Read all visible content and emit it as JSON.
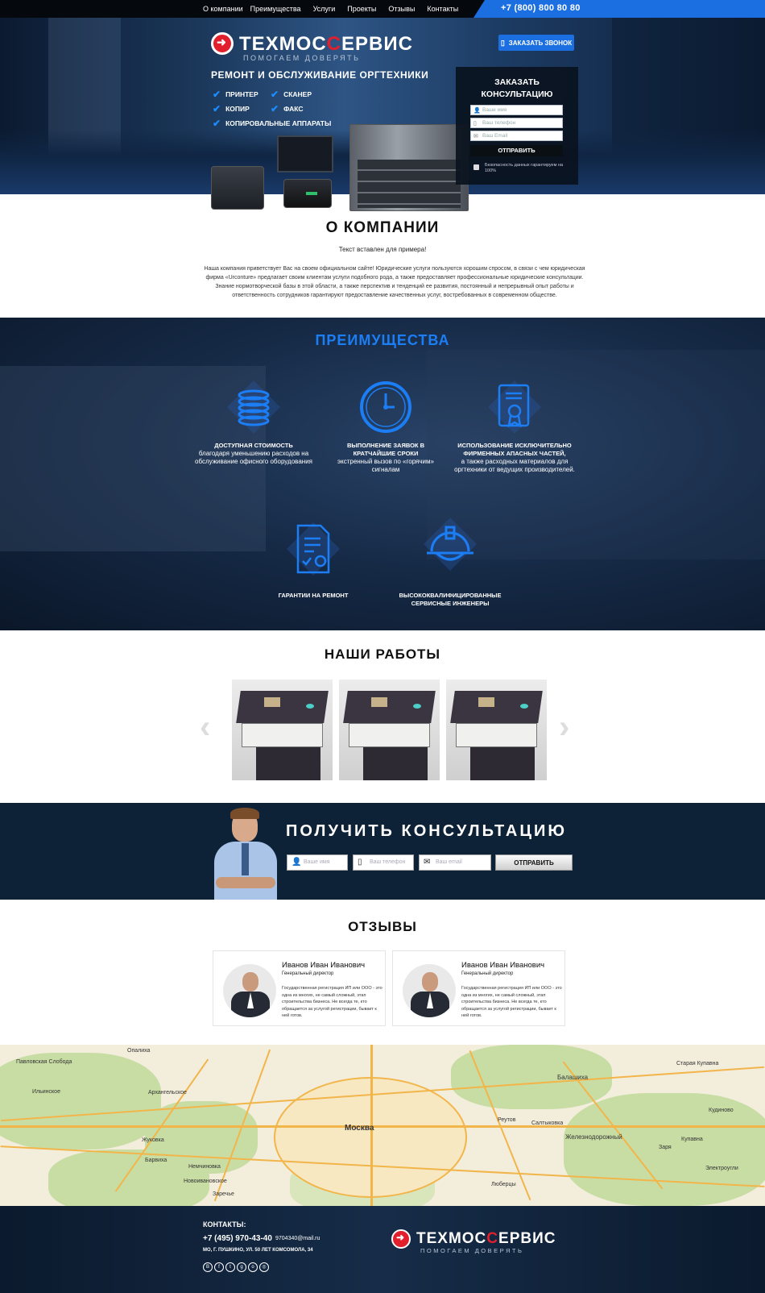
{
  "topbar": {
    "nav": [
      "О компании",
      "Преимущества",
      "Услуги",
      "Проекты",
      "Отзывы",
      "Контакты"
    ],
    "phone": "+7 (800) 800 80 80"
  },
  "logo": {
    "text_a": "ТЕХМОС",
    "text_b": "С",
    "text_c": "ЕРВИС",
    "slogan": "ПОМОГАЕМ ДОВЕРЯТЬ"
  },
  "hero": {
    "call_button": "ЗАКАЗАТЬ ЗВОНОК",
    "title": "РЕМОНТ И ОБСЛУЖИВАНИЕ ОРГТЕХНИКИ",
    "features": [
      "ПРИНТЕР",
      "СКАНЕР",
      "КОПИР",
      "ФАКС",
      "КОПИРОВАЛЬНЫЕ АППАРАТЫ"
    ]
  },
  "consult_form": {
    "title_line1": "ЗАКАЗАТЬ",
    "title_line2": "КОНСУЛЬТАЦИЮ",
    "name_placeholder": "Ваше имя",
    "phone_placeholder": "Ваш телефон",
    "email_placeholder": "Ваш Email",
    "submit": "ОТПРАВИТЬ",
    "security": "Безопасность данных гарантируем на 100%"
  },
  "about": {
    "title": "О КОМПАНИИ",
    "subtitle": "Текст вставлен для примера!",
    "text": "Наша компания приветствует Вас на своем официальном сайте! Юридические услуги пользуются  хорошим спросом, в связи с чем юридическая фирма «Urconture» предлагает своим клиентам услуги подобного рода, а также предоставляет профессиональные юридические консультации. Знание нормотворческой базы в этой области, а также перспектив и тенденций ее развития, постоянный и непрерывный опыт работы и ответственность сотрудников гарантируют предоставление качественных услуг, востребованных в современном обществе."
  },
  "advantages": {
    "title": "ПРЕИМУЩЕСТВА",
    "items": [
      {
        "icon": "coins-icon",
        "heading": "ДОСТУПНАЯ СТОИМОСТЬ",
        "text": "благодаря уменьшению расходов на обслуживание офисного оборудования"
      },
      {
        "icon": "clock-icon",
        "heading": "ВЫПОЛНЕНИЕ ЗАЯВОК В КРАТЧАЙШИЕ СРОКИ",
        "text": "экстренный вызов по «горячим» сигналам"
      },
      {
        "icon": "certificate-icon",
        "heading": "ИСПОЛЬЗОВАНИЕ ИСКЛЮЧИТЕЛЬНО ФИРМЕННЫХ АПАСНЫХ ЧАСТЕЙ,",
        "text": "а также расходных материалов для оргтехники от ведущих производителей."
      },
      {
        "icon": "document-icon",
        "heading": "ГАРАНТИИ НА РЕМОНТ",
        "text": ""
      },
      {
        "icon": "helmet-icon",
        "heading": "ВЫСОКОКВАЛИФИЦИРОВАННЫЕ СЕРВИСНЫЕ ИНЖЕНЕРЫ",
        "text": ""
      }
    ]
  },
  "works": {
    "title": "НАШИ РАБОТЫ"
  },
  "consult_strip": {
    "title": "ПОЛУЧИТЬ   КОНСУЛЬТАЦИЮ",
    "name_placeholder": "Ваше имя",
    "phone_placeholder": "Ваш телефон",
    "email_placeholder": "Ваш email",
    "submit": "ОТПРАВИТЬ"
  },
  "reviews": {
    "title": "ОТЗЫВЫ",
    "items": [
      {
        "name": "Иванов Иван Иванович",
        "position": "Генеральный директор",
        "text": "Государственная регистрация ИП или ООО - это одна из многих, не самый сложный, этап строительства бизнеса. Не всегда те, кто обращается за услугой регистрации, бывает к ней готов."
      },
      {
        "name": "Иванов Иван Иванович",
        "position": "Генеральный директор",
        "text": "Государственная регистрация ИП или ООО - это одна из многих, не самый сложный, этап строительства бизнеса. Не всегда те, кто обращается за услугой регистрации, бывает к ней готов."
      }
    ]
  },
  "map": {
    "labels": [
      "Павловская Слобода",
      "Опалиха",
      "Архангельское",
      "Ильинское",
      "Москва",
      "Реутов",
      "Балашиха",
      "Железнодорожный",
      "Старая Купавна",
      "Кудиново",
      "Электроугли",
      "Барвиха",
      "Немчиновка",
      "Новоивановское",
      "Заречье",
      "Салтыковка",
      "Люберцы",
      "Жуковка",
      "Заря",
      "Купавна"
    ]
  },
  "footer": {
    "contacts_label": "КОНТАКТЫ:",
    "phone": "+7 (495) 970-43-40",
    "email": "9704340@mail.ru",
    "address": "МО, Г. ПУШКИНО, УЛ. 50 ЛЕТ КОМСОМОЛА, 34"
  }
}
